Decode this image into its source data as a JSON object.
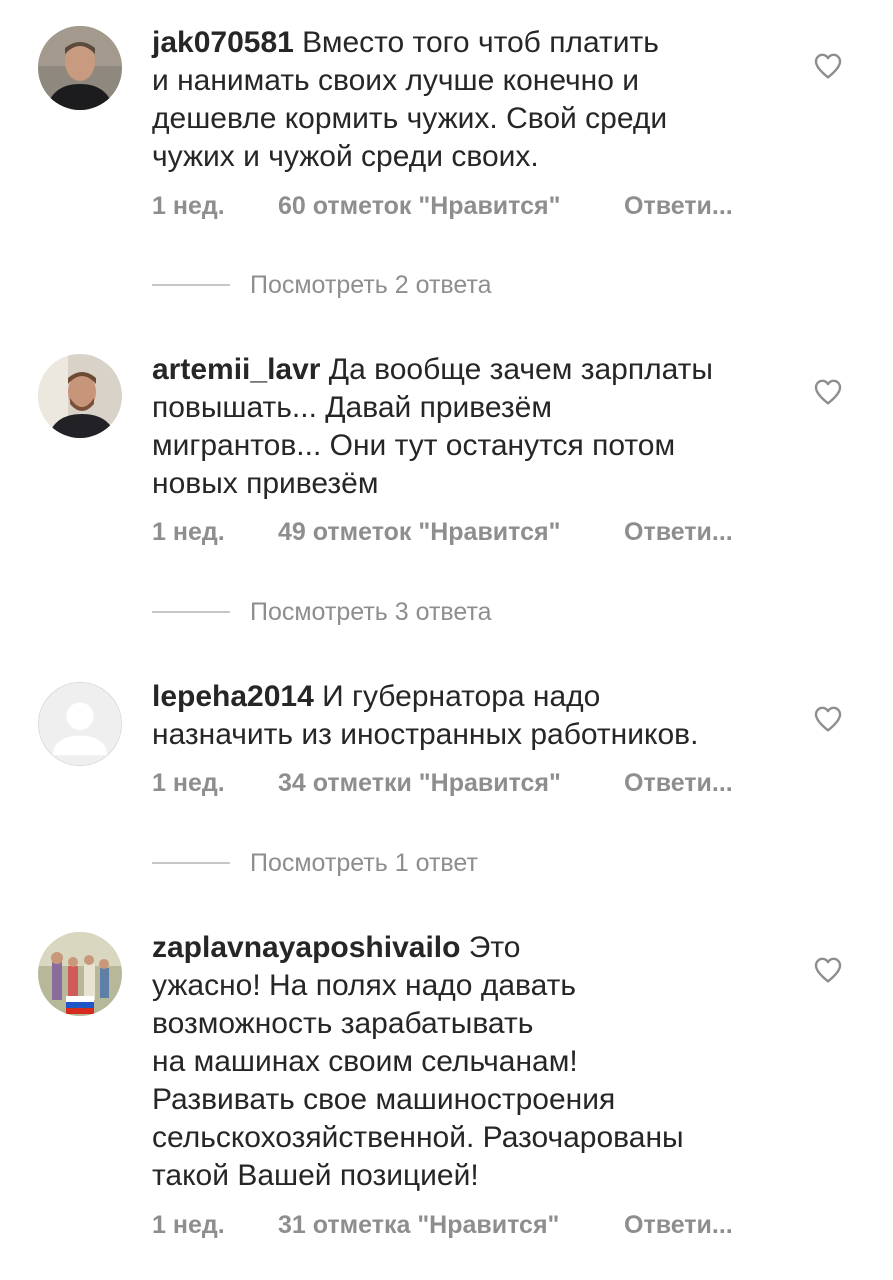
{
  "comments": [
    {
      "username": "jak070581",
      "lines": [
        "Вместо того чтоб платить",
        "и нанимать своих лучше конечно и",
        "дешевле кормить чужих. Свой среди",
        "чужих и чужой среди своих."
      ],
      "time": "1 нед.",
      "likes": "60 отметок \"Нравится\"",
      "reply": "Ответи...",
      "view_replies": "Посмотреть 2 ответа",
      "avatar_icon": "user-photo-man-dark-shirt"
    },
    {
      "username": "artemii_lavr",
      "lines": [
        "Да вообще зачем зарплаты",
        "повышать... Давай привезём",
        "мигрантов... Они тут останутся потом",
        "новых привезём"
      ],
      "time": "1 нед.",
      "likes": "49 отметок \"Нравится\"",
      "reply": "Ответи...",
      "view_replies": "Посмотреть 3 ответа",
      "avatar_icon": "user-photo-man-bearded"
    },
    {
      "username": "lepeha2014",
      "lines": [
        "И губернатора надо",
        "назначить из иностранных работников."
      ],
      "time": "1 нед.",
      "likes": "34 отметки \"Нравится\"",
      "reply": "Ответи...",
      "view_replies": "Посмотреть 1 ответ",
      "avatar_icon": "default-avatar-icon"
    },
    {
      "username": "zaplavnayaposhivailo",
      "lines": [
        "Это",
        "ужасно! На полях надо давать",
        "возможность зарабатывать",
        "на машинах своим сельчанам!",
        "Развивать свое машиностроения",
        "сельскохозяйственной. Разочарованы",
        "такой Вашей позицией!"
      ],
      "time": "1 нед.",
      "likes": "31 отметка \"Нравится\"",
      "reply": "Ответи...",
      "view_replies": "",
      "avatar_icon": "user-photo-group-with-flag"
    }
  ],
  "colors": {
    "text": "#262626",
    "meta": "#8e8e8e",
    "divider": "#c7c7c7"
  }
}
